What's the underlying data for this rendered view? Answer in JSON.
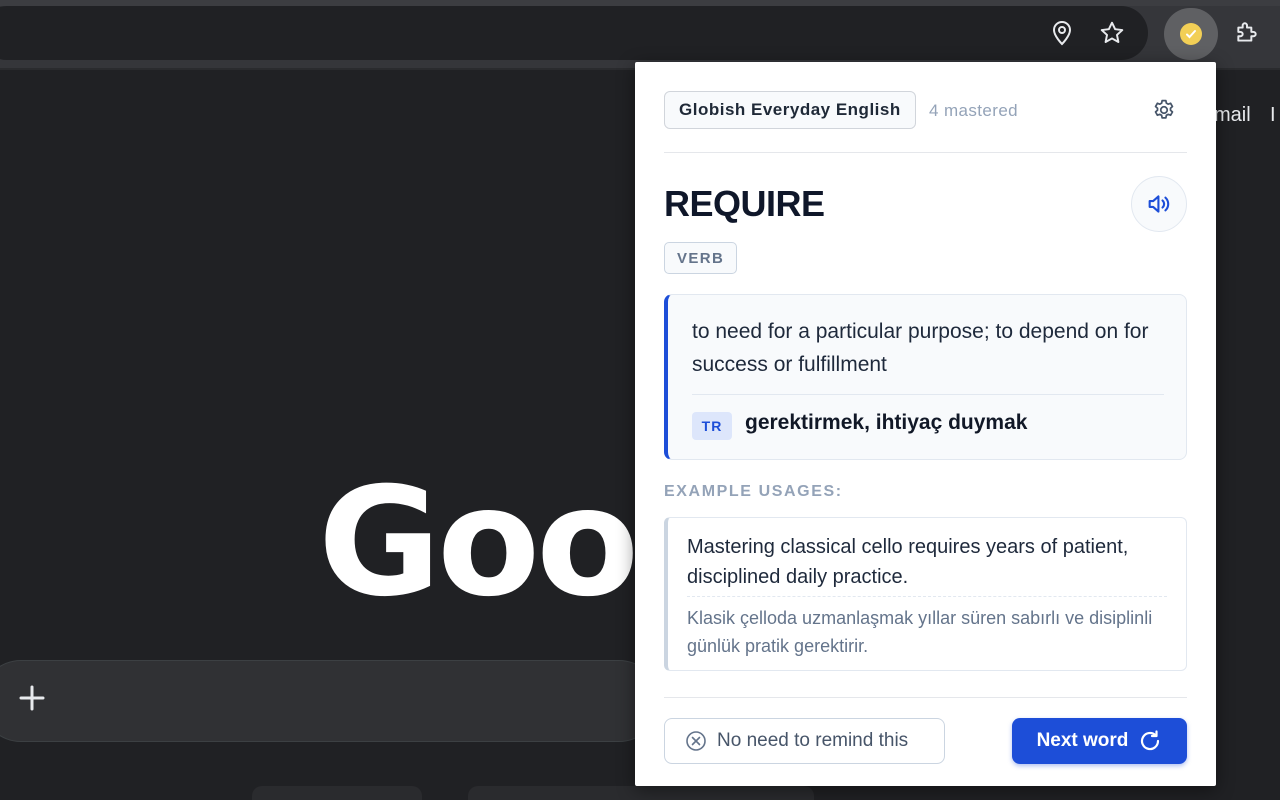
{
  "background_page": {
    "gmail_link": "mail",
    "gmail_cut": "I",
    "logo_text": "Google"
  },
  "popup": {
    "deck_name": "Globish Everyday English",
    "mastered_count": "4 mastered",
    "word": "REQUIRE",
    "part_of_speech": "VERB",
    "definition": "to need for a particular purpose; to depend on for success or fulfillment",
    "translation_lang": "TR",
    "translation": "gerektirmek, ihtiyaç duymak",
    "examples_label": "EXAMPLE USAGES:",
    "examples": [
      {
        "en": "Mastering classical cello requires years of patient, disciplined daily practice.",
        "tr": "Klasik çelloda uzmanlaşmak yıllar süren sabırlı ve disiplinli günlük pratik gerektirir."
      }
    ],
    "skip_label": "No need to remind this",
    "next_label": "Next word"
  },
  "icons": {
    "location": "location-pin-icon",
    "bookmark": "star-icon",
    "extension_active": "check-badge-icon",
    "extensions": "puzzle-icon",
    "settings": "gear-icon",
    "speaker": "speaker-icon",
    "skip": "x-circle-icon",
    "next": "refresh-icon",
    "new_tab": "plus-icon"
  },
  "colors": {
    "accent": "#1d4ed8",
    "badge_yellow": "#f2cf56"
  }
}
